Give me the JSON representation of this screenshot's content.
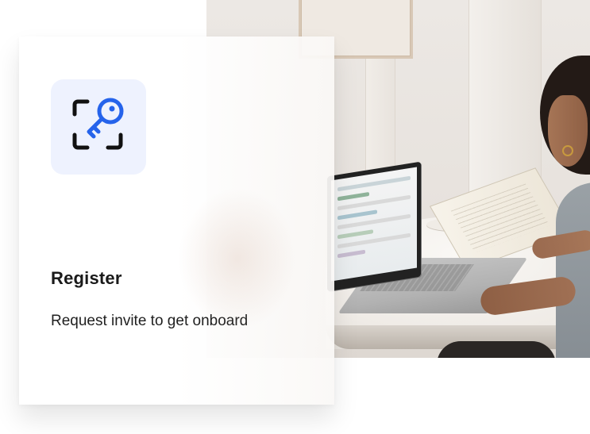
{
  "card": {
    "title": "Register",
    "subtitle": "Request invite to get onboard",
    "icon": "key-scan-icon"
  },
  "photo": {
    "subject": "person-working-on-laptop-image"
  },
  "colors": {
    "icon_primary": "#2563eb",
    "icon_secondary": "#111111",
    "icon_tile_bg": "#eef2fe",
    "text": "#1a1a1a"
  }
}
